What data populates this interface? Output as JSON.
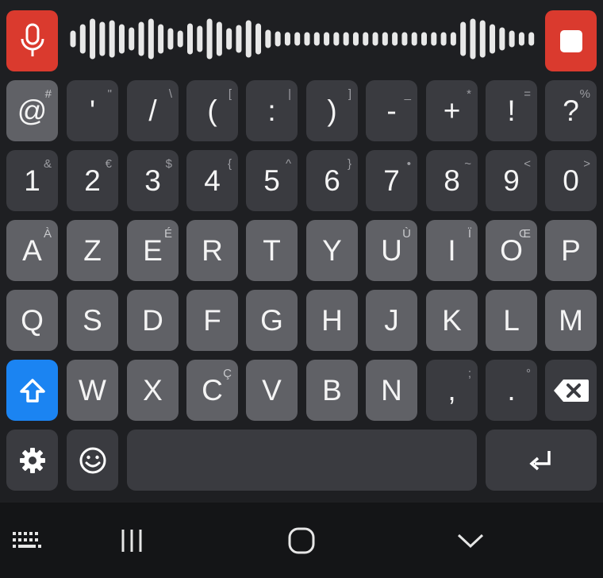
{
  "colors": {
    "background": "#1e1f22",
    "key_dark": "#3a3b40",
    "key_light": "#606166",
    "accent_red": "#da3a2e",
    "accent_blue": "#1b84f2",
    "nav_background": "#141517"
  },
  "voice": {
    "mic_icon": "microphone-icon",
    "stop_icon": "stop-icon"
  },
  "rows": {
    "symbols": [
      {
        "main": "@",
        "sub": "#"
      },
      {
        "main": "'",
        "sub": "\""
      },
      {
        "main": "/",
        "sub": "\\"
      },
      {
        "main": "(",
        "sub": "["
      },
      {
        "main": ":",
        "sub": "|"
      },
      {
        "main": ")",
        "sub": "]"
      },
      {
        "main": "-",
        "sub": "_"
      },
      {
        "main": "+",
        "sub": "*"
      },
      {
        "main": "!",
        "sub": "="
      },
      {
        "main": "?",
        "sub": "%"
      }
    ],
    "numbers": [
      {
        "main": "1",
        "sub": "&"
      },
      {
        "main": "2",
        "sub": "€"
      },
      {
        "main": "3",
        "sub": "$"
      },
      {
        "main": "4",
        "sub": "{"
      },
      {
        "main": "5",
        "sub": "^"
      },
      {
        "main": "6",
        "sub": "}"
      },
      {
        "main": "7",
        "sub": "•"
      },
      {
        "main": "8",
        "sub": "~"
      },
      {
        "main": "9",
        "sub": "<"
      },
      {
        "main": "0",
        "sub": ">"
      }
    ],
    "letters1": [
      {
        "main": "A",
        "sub": "À"
      },
      {
        "main": "Z",
        "sub": ""
      },
      {
        "main": "E",
        "sub": "É"
      },
      {
        "main": "R",
        "sub": ""
      },
      {
        "main": "T",
        "sub": ""
      },
      {
        "main": "Y",
        "sub": ""
      },
      {
        "main": "U",
        "sub": "Ù"
      },
      {
        "main": "I",
        "sub": "Ï"
      },
      {
        "main": "O",
        "sub": "Œ"
      },
      {
        "main": "P",
        "sub": ""
      }
    ],
    "letters2": [
      {
        "main": "Q",
        "sub": ""
      },
      {
        "main": "S",
        "sub": ""
      },
      {
        "main": "D",
        "sub": ""
      },
      {
        "main": "F",
        "sub": ""
      },
      {
        "main": "G",
        "sub": ""
      },
      {
        "main": "H",
        "sub": ""
      },
      {
        "main": "J",
        "sub": ""
      },
      {
        "main": "K",
        "sub": ""
      },
      {
        "main": "L",
        "sub": ""
      },
      {
        "main": "M",
        "sub": ""
      }
    ],
    "letters3": [
      {
        "main": "W",
        "sub": ""
      },
      {
        "main": "X",
        "sub": ""
      },
      {
        "main": "C",
        "sub": "Ç"
      },
      {
        "main": "V",
        "sub": ""
      },
      {
        "main": "B",
        "sub": ""
      },
      {
        "main": "N",
        "sub": ""
      }
    ],
    "punct": [
      {
        "main": ",",
        "sub": ";"
      },
      {
        "main": ".",
        "sub": "°"
      }
    ]
  },
  "function_keys": {
    "shift_icon": "shift-icon",
    "backspace_icon": "backspace-icon",
    "settings_icon": "settings-gear-icon",
    "emoji_icon": "emoji-icon",
    "enter_icon": "enter-icon"
  },
  "nav": {
    "keyboard_icon": "keyboard-icon",
    "recent_icon": "recent-apps-icon",
    "home_icon": "home-icon",
    "hide_icon": "hide-keyboard-icon"
  }
}
